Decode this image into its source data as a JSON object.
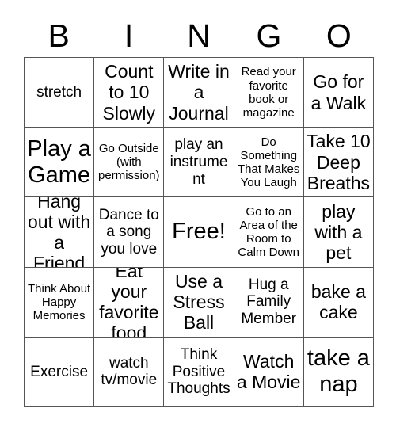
{
  "card": {
    "title": "BINGO",
    "header_letters": [
      "B",
      "I",
      "N",
      "G",
      "O"
    ],
    "grid_size": "5x5",
    "free_space_label": "Free!",
    "free_space_position": "row 3, column 3",
    "colors": {
      "background": "#ffffff",
      "text": "#000000",
      "grid_line": "#555555"
    },
    "rows": [
      {
        "cells": [
          {
            "text": "stretch",
            "size": "md"
          },
          {
            "text": "Count to 10 Slowly",
            "size": "lg"
          },
          {
            "text": "Write in a Journal",
            "size": "lg"
          },
          {
            "text": "Read your favorite book or magazine",
            "size": "sm"
          },
          {
            "text": "Go for a Walk",
            "size": "lg"
          }
        ]
      },
      {
        "cells": [
          {
            "text": "Play a Game",
            "size": "xl"
          },
          {
            "text": "Go Outside (with permission)",
            "size": "sm"
          },
          {
            "text": "play an instrument",
            "size": "md"
          },
          {
            "text": "Do Something That Makes You Laugh",
            "size": "sm"
          },
          {
            "text": "Take 10 Deep Breaths",
            "size": "lg"
          }
        ]
      },
      {
        "cells": [
          {
            "text": "Hang out with a Friend",
            "size": "lg"
          },
          {
            "text": "Dance to a song you love",
            "size": "md"
          },
          {
            "text": "Free!",
            "size": "xl"
          },
          {
            "text": "Go to an Area of the Room to Calm Down",
            "size": "sm"
          },
          {
            "text": "play with a pet",
            "size": "lg"
          }
        ]
      },
      {
        "cells": [
          {
            "text": "Think About Happy Memories",
            "size": "sm"
          },
          {
            "text": "Eat your favorite food",
            "size": "lg"
          },
          {
            "text": "Use a Stress Ball",
            "size": "lg"
          },
          {
            "text": "Hug a Family Member",
            "size": "md"
          },
          {
            "text": "bake a cake",
            "size": "lg"
          }
        ]
      },
      {
        "cells": [
          {
            "text": "Exercise",
            "size": "md"
          },
          {
            "text": "watch tv/movie",
            "size": "md"
          },
          {
            "text": "Think Positive Thoughts",
            "size": "md"
          },
          {
            "text": "Watch a Movie",
            "size": "lg"
          },
          {
            "text": "take a nap",
            "size": "xl"
          }
        ]
      }
    ]
  }
}
